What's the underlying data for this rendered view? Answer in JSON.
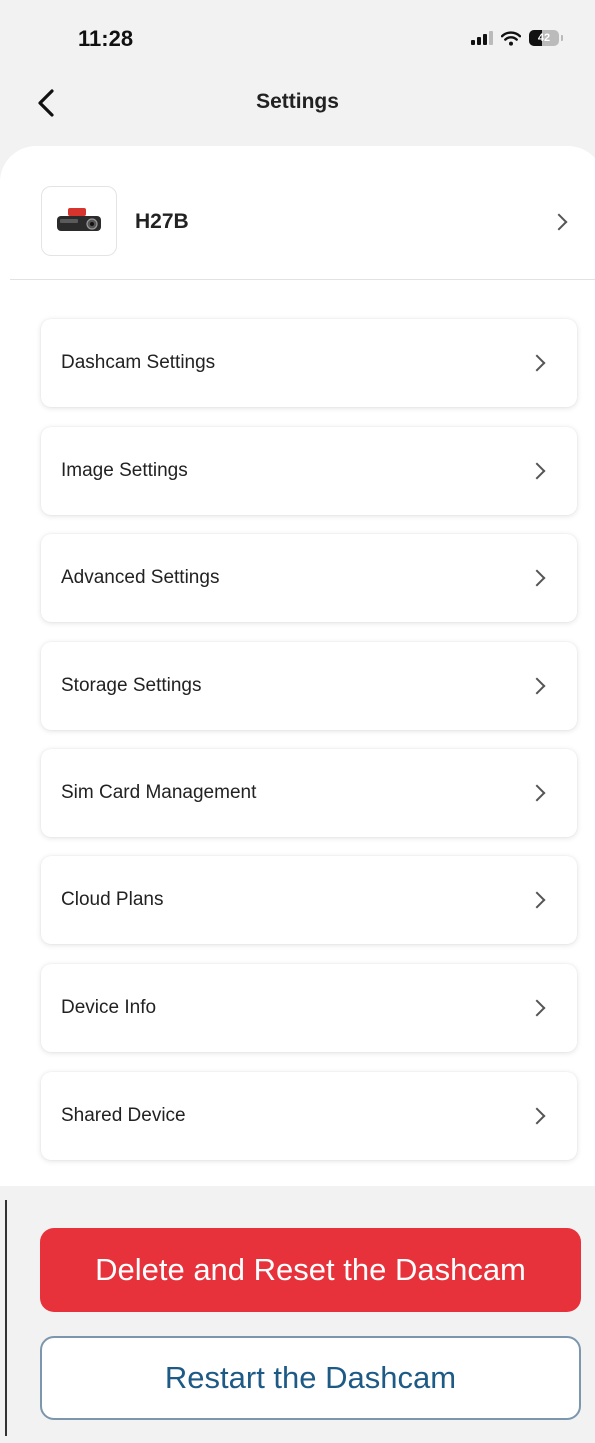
{
  "status_bar": {
    "time": "11:28",
    "battery_level": "42",
    "icons": [
      "signal-icon",
      "wifi-icon",
      "battery-icon"
    ]
  },
  "nav": {
    "title": "Settings",
    "back_icon": "chevron-left-icon"
  },
  "device": {
    "name": "H27B",
    "icon": "dashcam-icon"
  },
  "menu": {
    "items": [
      {
        "label": "Dashcam Settings"
      },
      {
        "label": "Image Settings"
      },
      {
        "label": "Advanced Settings"
      },
      {
        "label": "Storage Settings"
      },
      {
        "label": "Sim Card Management"
      },
      {
        "label": "Cloud Plans"
      },
      {
        "label": "Device Info"
      },
      {
        "label": "Shared Device"
      }
    ]
  },
  "actions": {
    "delete_label": "Delete and Reset the Dashcam",
    "restart_label": "Restart the Dashcam"
  },
  "colors": {
    "danger": "#e8323b",
    "secondary_text": "#1d5a86",
    "secondary_border": "#7b96ad",
    "background": "#f2f2f2"
  }
}
